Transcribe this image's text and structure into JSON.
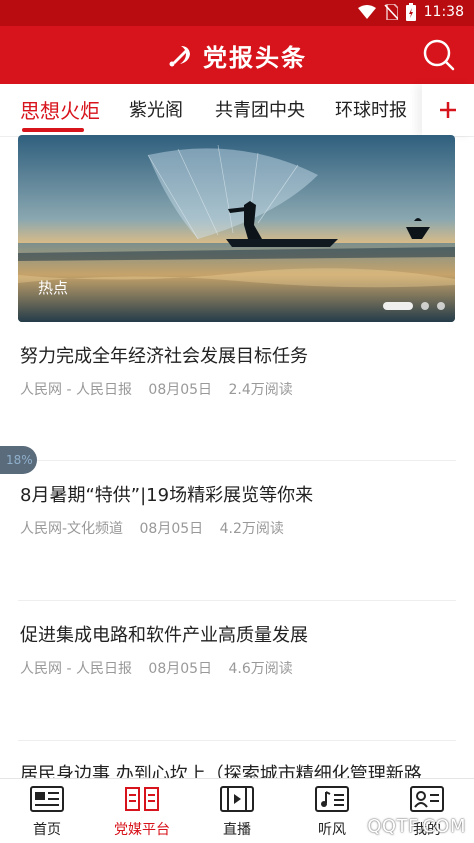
{
  "status_bar": {
    "time": "11:38"
  },
  "app": {
    "title": "党报头条",
    "brand_color": "#d7131b"
  },
  "tabs": [
    {
      "label": "思想火炬",
      "active": true
    },
    {
      "label": "紫光阁",
      "active": false
    },
    {
      "label": "共青团中央",
      "active": false
    },
    {
      "label": "环球时报",
      "active": false
    }
  ],
  "banner": {
    "caption": "热点",
    "dots": 3,
    "active_dot": 1
  },
  "news": [
    {
      "title": "努力完成全年经济社会发展目标任务",
      "source": "人民网 - 人民日报",
      "date": "08月05日",
      "reads": "2.4万阅读"
    },
    {
      "title": "8月暑期“特供”|19场精彩展览等你来",
      "source": "人民网-文化频道",
      "date": "08月05日",
      "reads": "4.2万阅读"
    },
    {
      "title": "促进集成电路和软件产业高质量发展",
      "source": "人民网 - 人民日报",
      "date": "08月05日",
      "reads": "4.6万阅读"
    },
    {
      "title": "居民身边事 办到心坎上（探索城市精细化管理新路",
      "source": "",
      "date": "",
      "reads": ""
    }
  ],
  "floating_badge": "18%",
  "bottom_nav": [
    {
      "label": "首页",
      "icon": "home-news-icon",
      "active": false
    },
    {
      "label": "党媒平台",
      "icon": "party-media-icon",
      "active": true
    },
    {
      "label": "直播",
      "icon": "live-video-icon",
      "active": false
    },
    {
      "label": "听风",
      "icon": "music-note-icon",
      "active": false
    },
    {
      "label": "我的",
      "icon": "profile-card-icon",
      "active": false
    }
  ],
  "watermark": "QQTF.COM"
}
